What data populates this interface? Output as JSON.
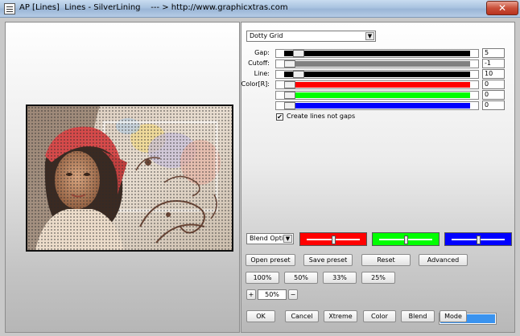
{
  "window": {
    "title": "AP [Lines]  Lines - SilverLining    --- > http://www.graphicxtras.com",
    "close_label": "✕"
  },
  "effect": {
    "selected": "Dotty Grid"
  },
  "sliders": [
    {
      "label": "Gap:",
      "value": "5",
      "level": 0.05,
      "color": "#000000"
    },
    {
      "label": "Cutoff:",
      "value": "-1",
      "level": 0.0,
      "color": "#808080"
    },
    {
      "label": "Line:",
      "value": "10",
      "level": 0.05,
      "color": "#000000"
    },
    {
      "label": "Color[R]:",
      "value": "0",
      "level": 0.0,
      "color": "#ff0000"
    },
    {
      "label": "",
      "value": "0",
      "level": 0.0,
      "color": "#00ff00"
    },
    {
      "label": "",
      "value": "0",
      "level": 0.0,
      "color": "#0000ff"
    }
  ],
  "options": {
    "create_lines_label": "Create lines not gaps",
    "create_lines_checked": true,
    "check_mark": "✔"
  },
  "blend": {
    "selected": "Blend Optio",
    "red_level": 0.5,
    "green_level": 0.5,
    "blue_level": 0.5,
    "red_color": "#ff0000",
    "green_color": "#00ff00",
    "blue_color": "#0000ff"
  },
  "buttons": {
    "open_preset": "Open preset",
    "save_preset": "Save preset",
    "reset": "Reset",
    "advanced": "Advanced",
    "zoom_100": "100%",
    "zoom_50": "50%",
    "zoom_33": "33%",
    "zoom_25": "25%",
    "zoom_in": "+",
    "zoom_out": "−",
    "ok": "OK",
    "cancel": "Cancel",
    "xtreme": "Xtreme",
    "color": "Color",
    "blend": "Blend",
    "mode": "Mode"
  },
  "zoom": {
    "value": "50%"
  },
  "swatch": {
    "color": "#3a93ef"
  }
}
